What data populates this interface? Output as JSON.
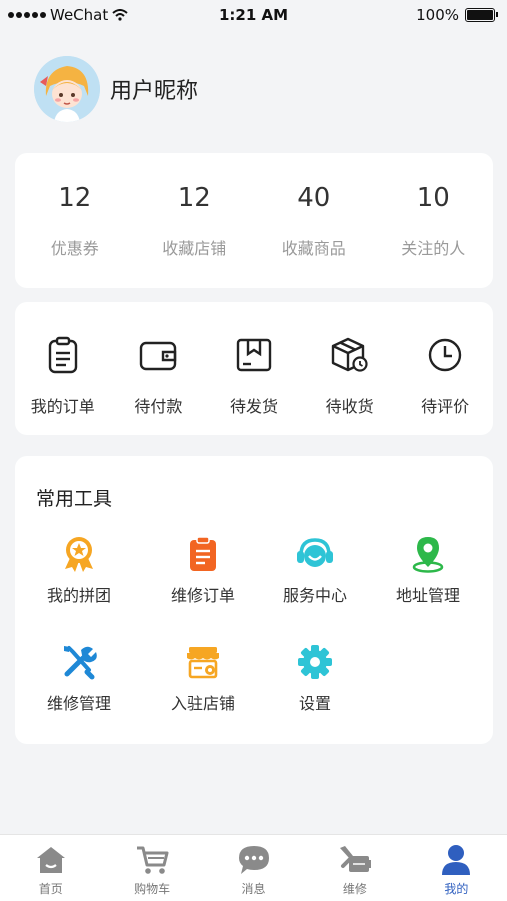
{
  "status_bar": {
    "carrier": "WeChat",
    "time": "1:21 AM",
    "battery": "100%"
  },
  "profile": {
    "nickname": "用户昵称"
  },
  "stats": [
    {
      "value": "12",
      "label": "优惠券"
    },
    {
      "value": "12",
      "label": "收藏店铺"
    },
    {
      "value": "40",
      "label": "收藏商品"
    },
    {
      "value": "10",
      "label": "关注的人"
    }
  ],
  "orders": [
    {
      "label": "我的订单",
      "icon": "clipboard-icon"
    },
    {
      "label": "待付款",
      "icon": "wallet-icon"
    },
    {
      "label": "待发货",
      "icon": "package-icon"
    },
    {
      "label": "待收货",
      "icon": "box-receive-icon"
    },
    {
      "label": "待评价",
      "icon": "clock-icon"
    }
  ],
  "tools": {
    "title": "常用工具",
    "items": [
      {
        "label": "我的拼团",
        "icon": "medal-icon",
        "color": "#f6a623"
      },
      {
        "label": "维修订单",
        "icon": "order-list-icon",
        "color": "#f26522"
      },
      {
        "label": "服务中心",
        "icon": "headset-icon",
        "color": "#2ec4d6"
      },
      {
        "label": "地址管理",
        "icon": "location-pin-icon",
        "color": "#2db84a"
      },
      {
        "label": "维修管理",
        "icon": "wrench-icon",
        "color": "#1e88d6"
      },
      {
        "label": "入驻店铺",
        "icon": "store-icon",
        "color": "#f6a623"
      },
      {
        "label": "设置",
        "icon": "gear-icon",
        "color": "#2ec4d6"
      }
    ]
  },
  "tabbar": [
    {
      "label": "首页",
      "icon": "home-icon"
    },
    {
      "label": "购物车",
      "icon": "cart-icon"
    },
    {
      "label": "消息",
      "icon": "message-icon"
    },
    {
      "label": "维修",
      "icon": "repair-icon"
    },
    {
      "label": "我的",
      "icon": "user-icon",
      "active": true
    }
  ],
  "colors": {
    "active_tab": "#2f5fbf",
    "inactive_icon": "#8a8a8a"
  }
}
